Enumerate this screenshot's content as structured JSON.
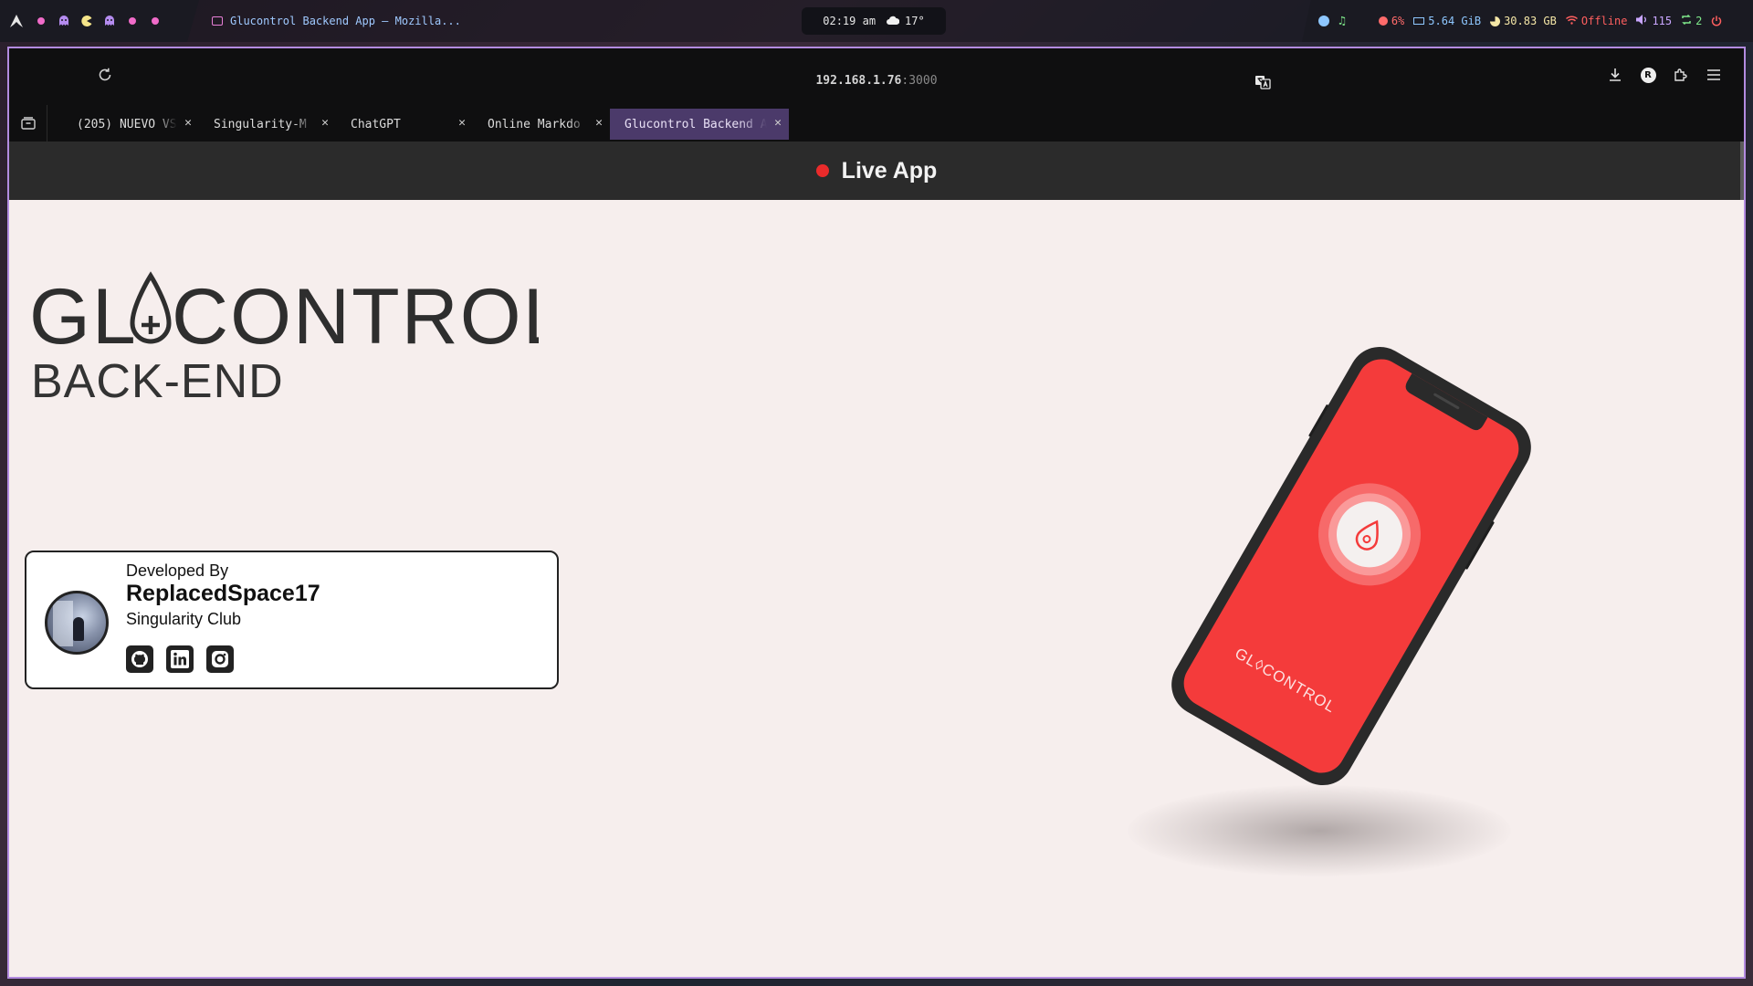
{
  "topbar": {
    "window_title": "Glucontrol Backend App — Mozilla...",
    "time": "02:19 am",
    "weather": "17°",
    "cpu": "6%",
    "ram": "5.64 GiB",
    "disk": "30.83 GB",
    "network": "Offline",
    "volume": "115",
    "updates": "2"
  },
  "browser": {
    "url_host": "192.168.1.76",
    "url_port": ":3000",
    "tabs": [
      {
        "label": "(205) NUEVO VS"
      },
      {
        "label": "Singularity-M"
      },
      {
        "label": "ChatGPT"
      },
      {
        "label": "Online Markdo"
      },
      {
        "label": "Glucontrol Backend A"
      }
    ]
  },
  "page": {
    "live_label": "Live App",
    "logo_text": "GLUCONTROL",
    "subtitle": "BACK-END",
    "developer": {
      "heading": "Developed By",
      "name": "ReplacedSpace17",
      "organization": "Singularity Club"
    },
    "phone_logo": "GLUCONTROL"
  },
  "colors": {
    "accent_red": "#f43b3b",
    "page_bg": "#f6eeed",
    "live_bar": "#2b2b2b",
    "active_tab": "#4b3a6a",
    "window_border": "#b38be0"
  }
}
